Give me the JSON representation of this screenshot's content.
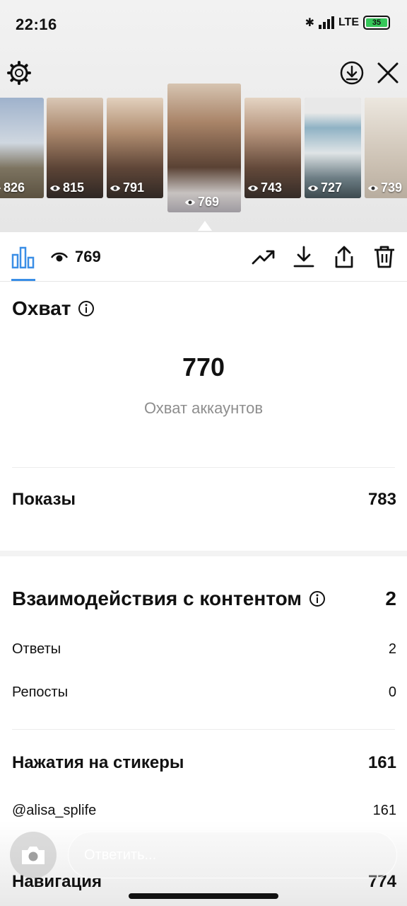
{
  "status": {
    "time": "22:16",
    "network": "LTE",
    "battery": "35"
  },
  "stories": [
    {
      "views": "826",
      "bg": "#7a95b8"
    },
    {
      "views": "815",
      "bg": "#b49a80"
    },
    {
      "views": "791",
      "bg": "#b8a48f"
    },
    {
      "views": "769",
      "bg": "#a88d75",
      "active": true
    },
    {
      "views": "743",
      "bg": "#c2ab95"
    },
    {
      "views": "727",
      "bg": "#8ea1a6"
    },
    {
      "views": "739",
      "bg": "#d9d2c8"
    }
  ],
  "toolbar": {
    "views": "769"
  },
  "reach": {
    "title": "Охват",
    "value": "770",
    "caption": "Охват аккаунтов"
  },
  "impressions": {
    "label": "Показы",
    "value": "783"
  },
  "interactions": {
    "title": "Взаимодействия с контентом",
    "value": "2",
    "rows": [
      {
        "label": "Ответы",
        "value": "2"
      },
      {
        "label": "Репосты",
        "value": "0"
      }
    ]
  },
  "stickers": {
    "title": "Нажатия на стикеры",
    "value": "161",
    "rows": [
      {
        "label": "@alisa_splife",
        "value": "161"
      }
    ]
  },
  "navigation": {
    "title": "Навигация",
    "value": "774"
  },
  "reply": {
    "placeholder": "Ответить..."
  },
  "colors": {
    "accent": "#3a8ee6",
    "battery": "#35c759"
  }
}
